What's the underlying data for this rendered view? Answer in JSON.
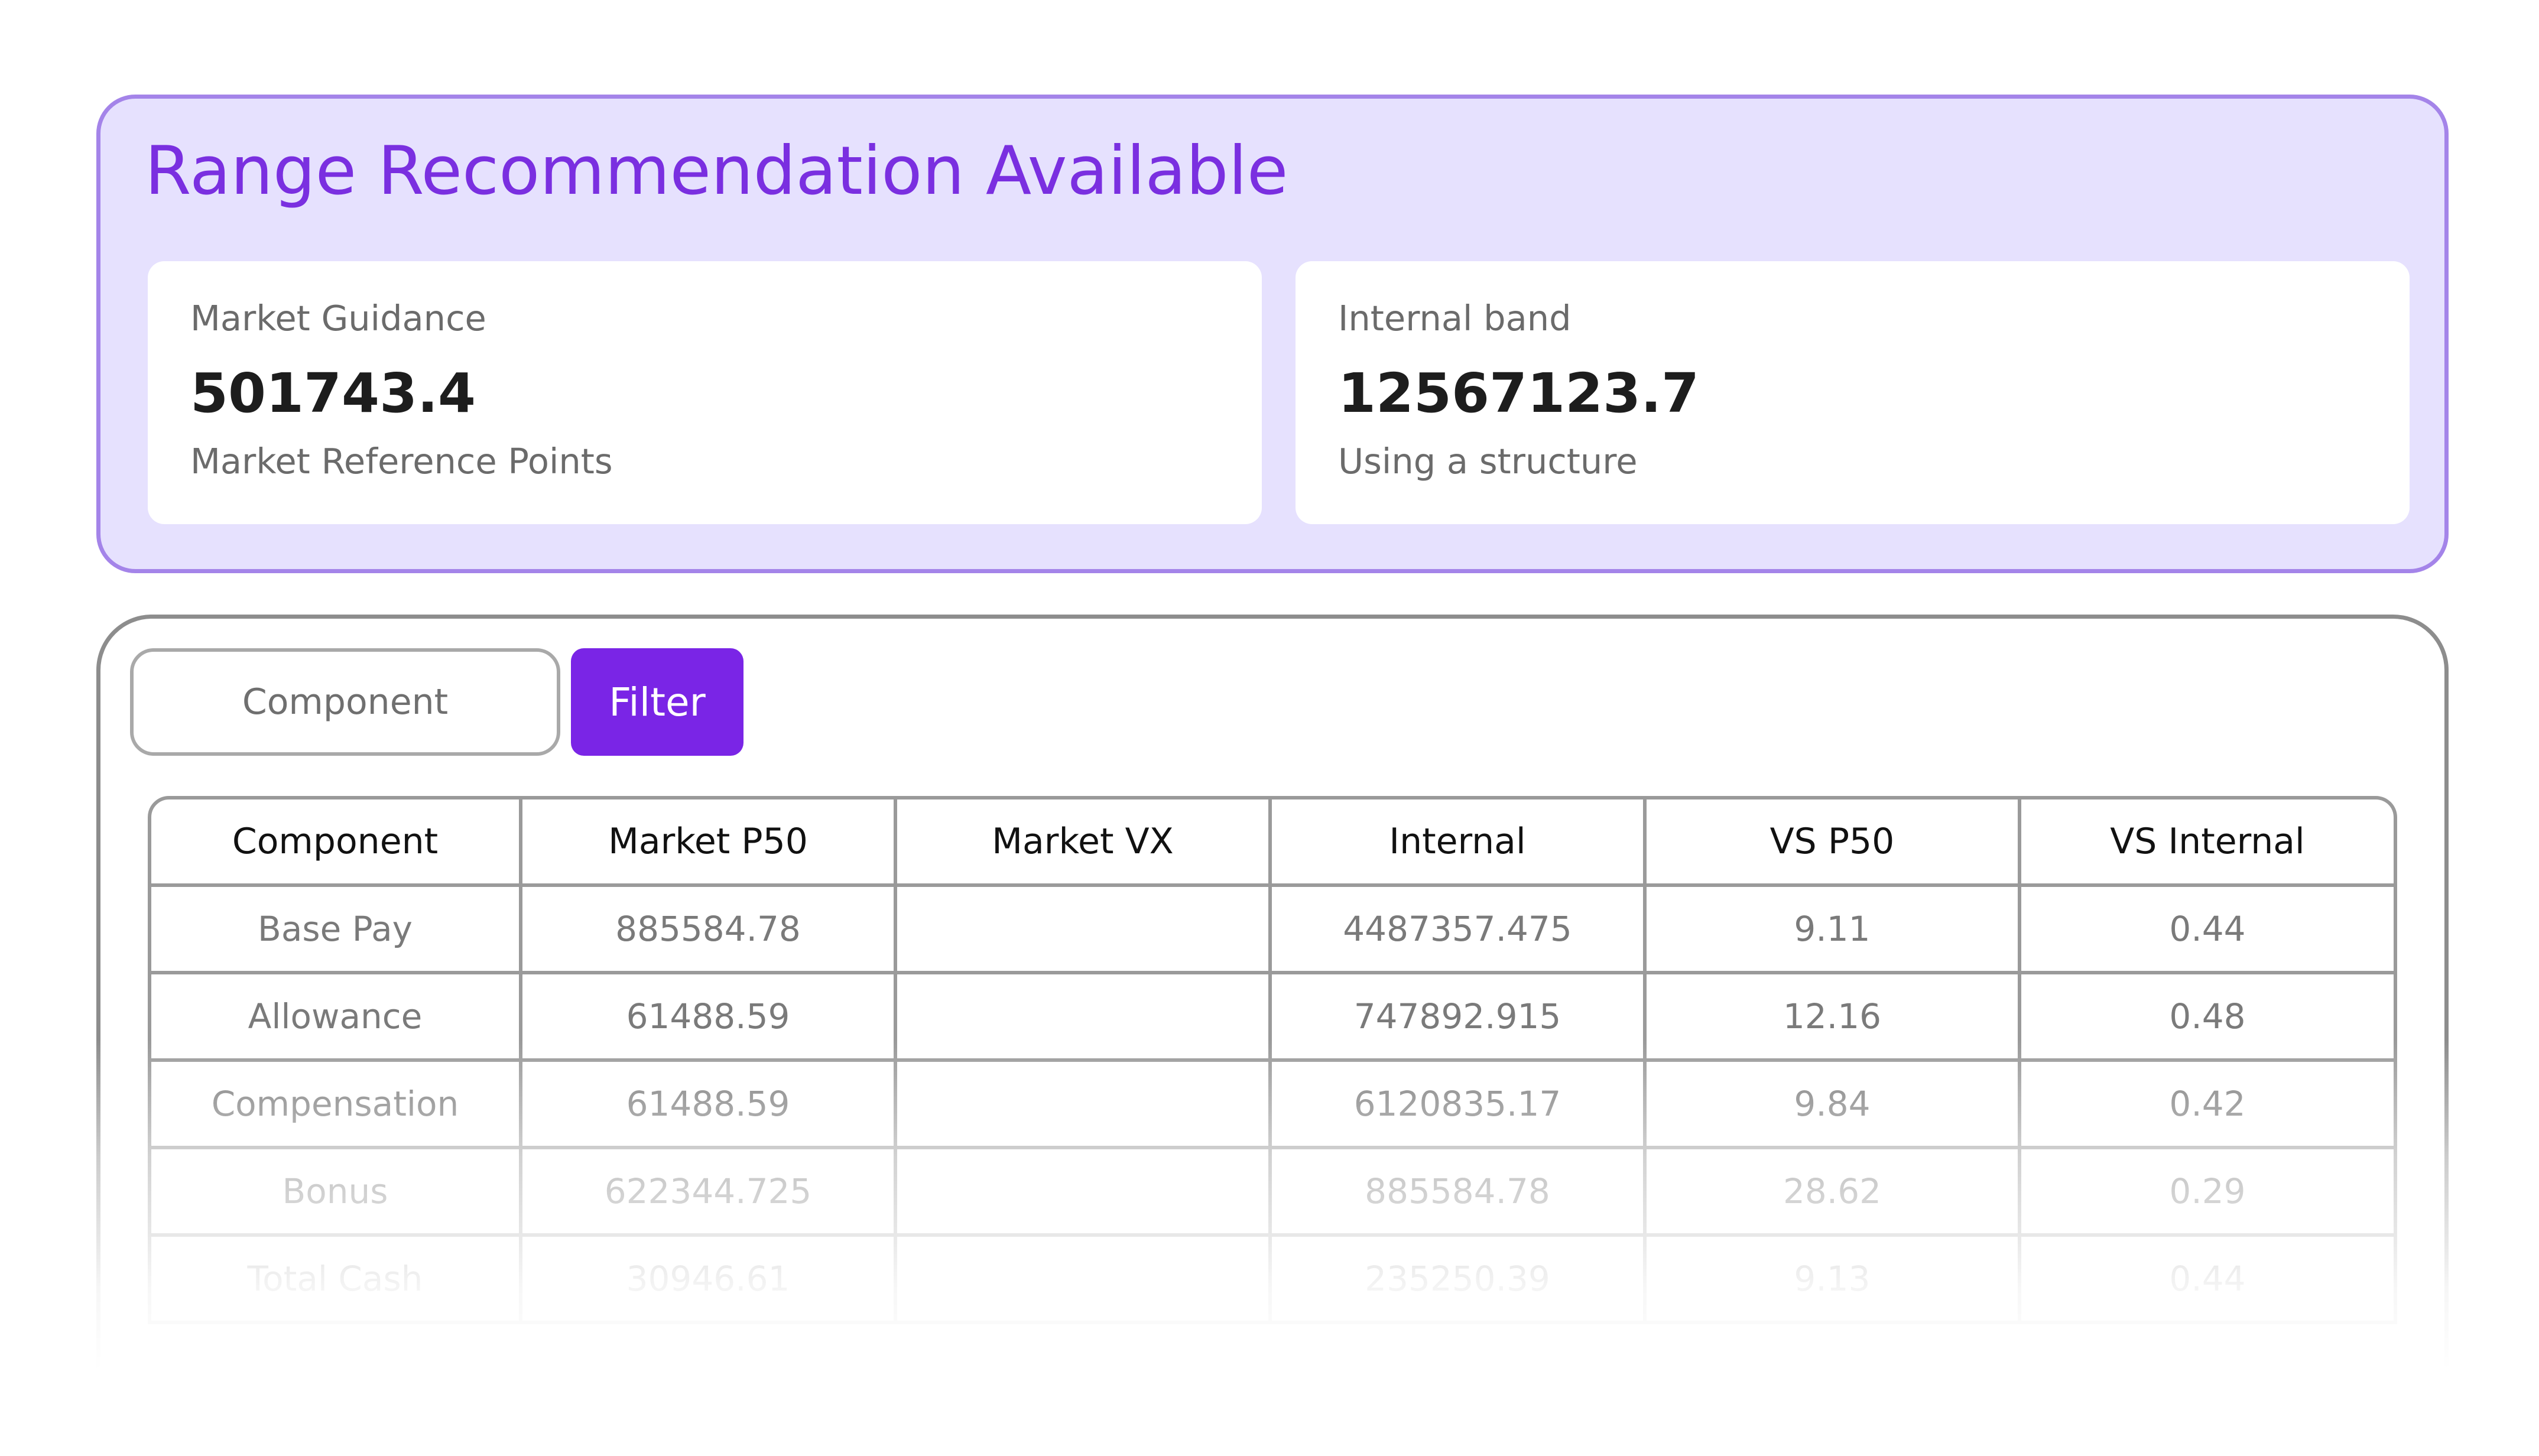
{
  "recommendation": {
    "title": "Range Recommendation Available",
    "cards": [
      {
        "label": "Market Guidance",
        "value": "501743.4",
        "note": "Market Reference Points"
      },
      {
        "label": "Internal band",
        "value": "12567123.7",
        "note": "Using a structure"
      }
    ]
  },
  "filter": {
    "placeholder": "Component",
    "button_label": "Filter"
  },
  "table": {
    "headers": [
      "Component",
      "Market P50",
      "Market VX",
      "Internal",
      "VS P50",
      "VS Internal"
    ],
    "rows": [
      [
        "Base Pay",
        "885584.78",
        "",
        "4487357.475",
        "9.11",
        "0.44"
      ],
      [
        "Allowance",
        "61488.59",
        "",
        "747892.915",
        "12.16",
        "0.48"
      ],
      [
        "Compensation",
        "61488.59",
        "",
        "6120835.17",
        "9.84",
        "0.42"
      ],
      [
        "Bonus",
        "622344.725",
        "",
        "885584.78",
        "28.62",
        "0.29"
      ],
      [
        "Total Cash",
        "30946.61",
        "",
        "235250.39",
        "9.13",
        "0.44"
      ]
    ]
  },
  "colors": {
    "accent": "#7a25e6",
    "panel_background": "#e6e1fe",
    "panel_border": "#a484e9"
  }
}
